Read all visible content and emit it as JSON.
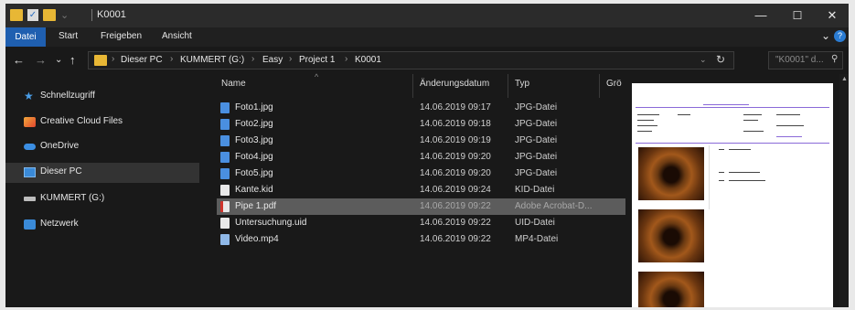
{
  "window": {
    "title": "K0001",
    "controls": {
      "minimize": "—",
      "maximize": "☐",
      "close": "✕"
    }
  },
  "ribbon": {
    "tabs": [
      "Datei",
      "Start",
      "Freigeben",
      "Ansicht"
    ]
  },
  "address": {
    "crumbs": [
      "Dieser PC",
      "KUMMERT (G:)",
      "Easy",
      "Project 1",
      "K0001"
    ],
    "search_placeholder": "\"K0001\" d..."
  },
  "sidebar": {
    "items": [
      {
        "label": "Schnellzugriff",
        "icon": "star-icon"
      },
      {
        "label": "Creative Cloud Files",
        "icon": "creative-cloud-icon"
      },
      {
        "label": "OneDrive",
        "icon": "cloud-icon"
      },
      {
        "label": "Dieser PC",
        "icon": "computer-icon",
        "selected": true
      },
      {
        "label": "KUMMERT (G:)",
        "icon": "drive-icon"
      },
      {
        "label": "Netzwerk",
        "icon": "network-icon"
      }
    ]
  },
  "columns": {
    "name": "Name",
    "date": "Änderungsdatum",
    "type": "Typ",
    "size": "Grö"
  },
  "files": [
    {
      "name": "Foto1.jpg",
      "date": "14.06.2019 09:17",
      "type": "JPG-Datei",
      "icon": "image-file-icon"
    },
    {
      "name": "Foto2.jpg",
      "date": "14.06.2019 09:18",
      "type": "JPG-Datei",
      "icon": "image-file-icon"
    },
    {
      "name": "Foto3.jpg",
      "date": "14.06.2019 09:19",
      "type": "JPG-Datei",
      "icon": "image-file-icon"
    },
    {
      "name": "Foto4.jpg",
      "date": "14.06.2019 09:20",
      "type": "JPG-Datei",
      "icon": "image-file-icon"
    },
    {
      "name": "Foto5.jpg",
      "date": "14.06.2019 09:20",
      "type": "JPG-Datei",
      "icon": "image-file-icon"
    },
    {
      "name": "Kante.kid",
      "date": "14.06.2019 09:24",
      "type": "KID-Datei",
      "icon": "generic-file-icon"
    },
    {
      "name": "Pipe 1.pdf",
      "date": "14.06.2019 09:22",
      "type": "Adobe Acrobat-D...",
      "icon": "pdf-file-icon",
      "selected": true
    },
    {
      "name": "Untersuchung.uid",
      "date": "14.06.2019 09:22",
      "type": "UID-Datei",
      "icon": "generic-file-icon"
    },
    {
      "name": "Video.mp4",
      "date": "14.06.2019 09:22",
      "type": "MP4-Datei",
      "icon": "video-file-icon"
    }
  ],
  "colors": {
    "accent": "#1f5fb0",
    "folder": "#e8b735",
    "background": "#191919",
    "selection": "#5c5c5c"
  }
}
